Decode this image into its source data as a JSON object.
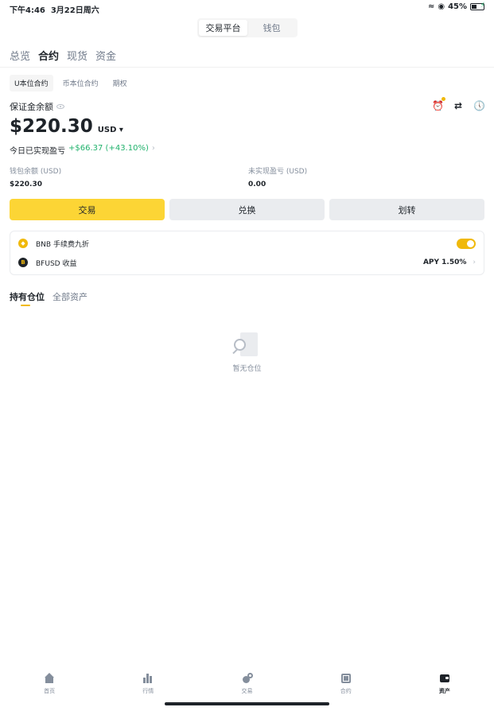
{
  "status_bar": {
    "time": "下午4:46",
    "date": "3月22日周六",
    "battery": "45%",
    "battery_level": 0.45
  },
  "segment": {
    "items": [
      "交易平台",
      "钱包"
    ],
    "active": 0
  },
  "main_tabs": [
    "总览",
    "合约",
    "现货",
    "资金"
  ],
  "sub_tabs": [
    "U本位合约",
    "币本位合约",
    "期权"
  ],
  "account": {
    "margin_label": "保证金余额",
    "balance": "$220.30",
    "unit": "USD",
    "pnl_label": "今日已实现盈亏",
    "pnl_value": "+$66.37 (+43.10%)",
    "wallet_label": "钱包余额 (USD)",
    "wallet_value": "$220.30",
    "unrealized_label": "未实现盈亏 (USD)",
    "unrealized_value": "0.00"
  },
  "actions": [
    "交易",
    "兑换",
    "划转"
  ],
  "card": {
    "bnb_label": "BNB 手续费九折",
    "bnb_toggle_on": true,
    "bfusd_label": "BFUSD 收益",
    "apy": "APY 1.50%"
  },
  "positions": {
    "tabs": [
      "持有仓位",
      "全部资产"
    ],
    "empty_text": "暂无仓位"
  },
  "bottom_nav": [
    "首页",
    "行情",
    "交易",
    "合约",
    "资产"
  ],
  "colors": {
    "brand_yellow": "#fcd535",
    "accent": "#f0b90b",
    "profit_green": "#20b26c",
    "text": "#1e2329",
    "muted": "#848e9c"
  },
  "icons": [
    "wifi-icon",
    "lock-rotation-icon",
    "battery-icon",
    "eye-icon",
    "alarm-clock-icon",
    "swap-icon",
    "history-icon",
    "bnb-coin-icon",
    "bfusd-coin-icon",
    "empty-search-icon",
    "home-icon",
    "markets-icon",
    "trade-icon",
    "futures-icon",
    "wallet-icon"
  ]
}
